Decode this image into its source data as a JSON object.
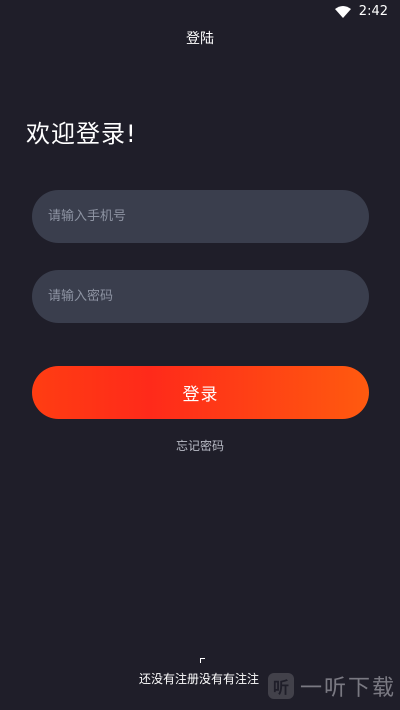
{
  "status_bar": {
    "time": "2:42",
    "icons": [
      "wifi-icon"
    ]
  },
  "header": {
    "title": "登陆"
  },
  "welcome": {
    "text": "欢迎登录!"
  },
  "form": {
    "phone_placeholder": "请输入手机号",
    "password_placeholder": "请输入密码",
    "login_label": "登录",
    "forgot_label": "忘记密码"
  },
  "footer": {
    "register_text": "还没有注册没有有注注"
  },
  "watermark": {
    "logo_text": "听",
    "text": "一听下载"
  },
  "colors": {
    "background": "#1f1e29",
    "input_background": "#3a3e4d",
    "accent_start": "#ff3d12",
    "accent_end": "#ff5a0f"
  }
}
